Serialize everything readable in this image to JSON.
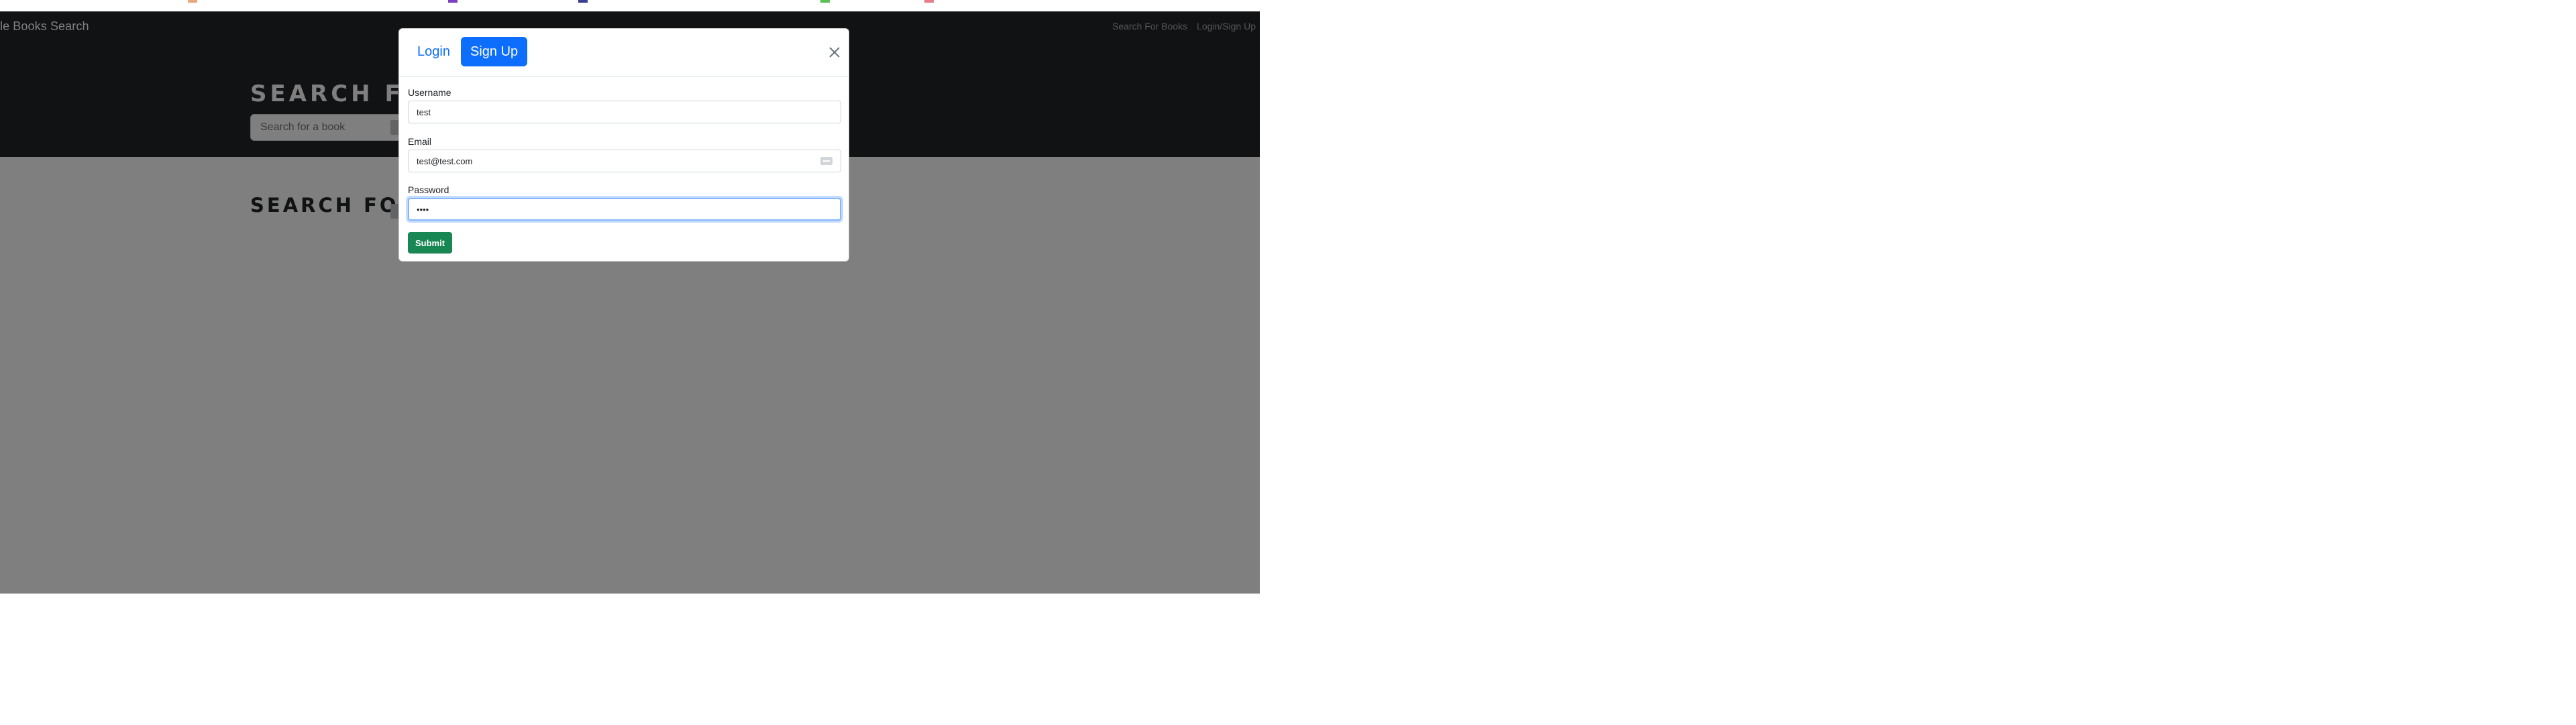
{
  "navbar": {
    "brand": "le Books Search",
    "links": [
      "Search For Books",
      "Login/Sign Up"
    ]
  },
  "hero": {
    "title": "SEARCH F",
    "search_placeholder": "Search for a book"
  },
  "results": {
    "title": "SEARCH FOR"
  },
  "modal": {
    "tabs": [
      "Login",
      "Sign Up"
    ],
    "active_tab": "Sign Up",
    "fields": [
      {
        "label": "Username",
        "value": "test"
      },
      {
        "label": "Email",
        "value": "test@test.com"
      },
      {
        "label": "Password",
        "value": "••••"
      }
    ],
    "submit_label": "Submit"
  },
  "colors": {
    "dark": "#212529",
    "primary": "#0d6efd",
    "success": "#198754",
    "nav_link": "#a9adb2",
    "focus_ring": "#86b7fe"
  },
  "strip_marks": [
    {
      "color": "#e8a87c"
    },
    {
      "color": "#7b3fbf"
    },
    {
      "color": "#3c3f8f"
    },
    {
      "color": "#5cbf57"
    },
    {
      "color": "#e87c8a"
    }
  ]
}
